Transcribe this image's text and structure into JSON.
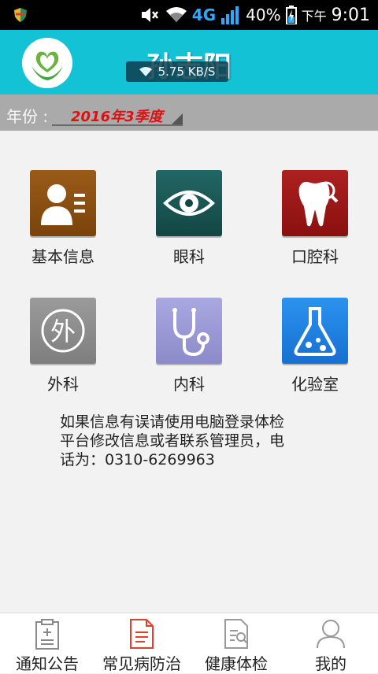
{
  "status_bar": {
    "network": "4G",
    "battery": "40%",
    "ampm": "下午",
    "time": "9:01",
    "net_speed": "5.75 KB/S"
  },
  "header": {
    "user_name": "孙志阳",
    "logo_icon": "heart-hands-logo-icon"
  },
  "year_filter": {
    "label": "年份 :",
    "selected": "2016年3季度"
  },
  "grid": [
    {
      "label": "基本信息",
      "icon": "id-card-icon",
      "color": "#8e5212"
    },
    {
      "label": "眼科",
      "icon": "eye-icon",
      "color": "#1a5a57"
    },
    {
      "label": "口腔科",
      "icon": "tooth-icon",
      "color": "#9e1818"
    },
    {
      "label": "外科",
      "icon": "surgery-glyph-icon",
      "glyph": "外",
      "color": "#8e8e8e"
    },
    {
      "label": "内科",
      "icon": "stethoscope-icon",
      "color": "#9c9ad8"
    },
    {
      "label": "化验室",
      "icon": "flask-icon",
      "color": "#1f86e8"
    }
  ],
  "notice": {
    "line1": "如果信息有误请使用电脑登录体检",
    "line2": "平台修改信息或者联系管理员，电",
    "line3": "话为：0310-6269963"
  },
  "tabs": [
    {
      "label": "通知公告",
      "icon": "clipboard-icon",
      "active": false
    },
    {
      "label": "常见病防治",
      "icon": "document-icon",
      "active": true
    },
    {
      "label": "健康体检",
      "icon": "report-search-icon",
      "active": false
    },
    {
      "label": "我的",
      "icon": "user-icon",
      "active": false
    }
  ]
}
